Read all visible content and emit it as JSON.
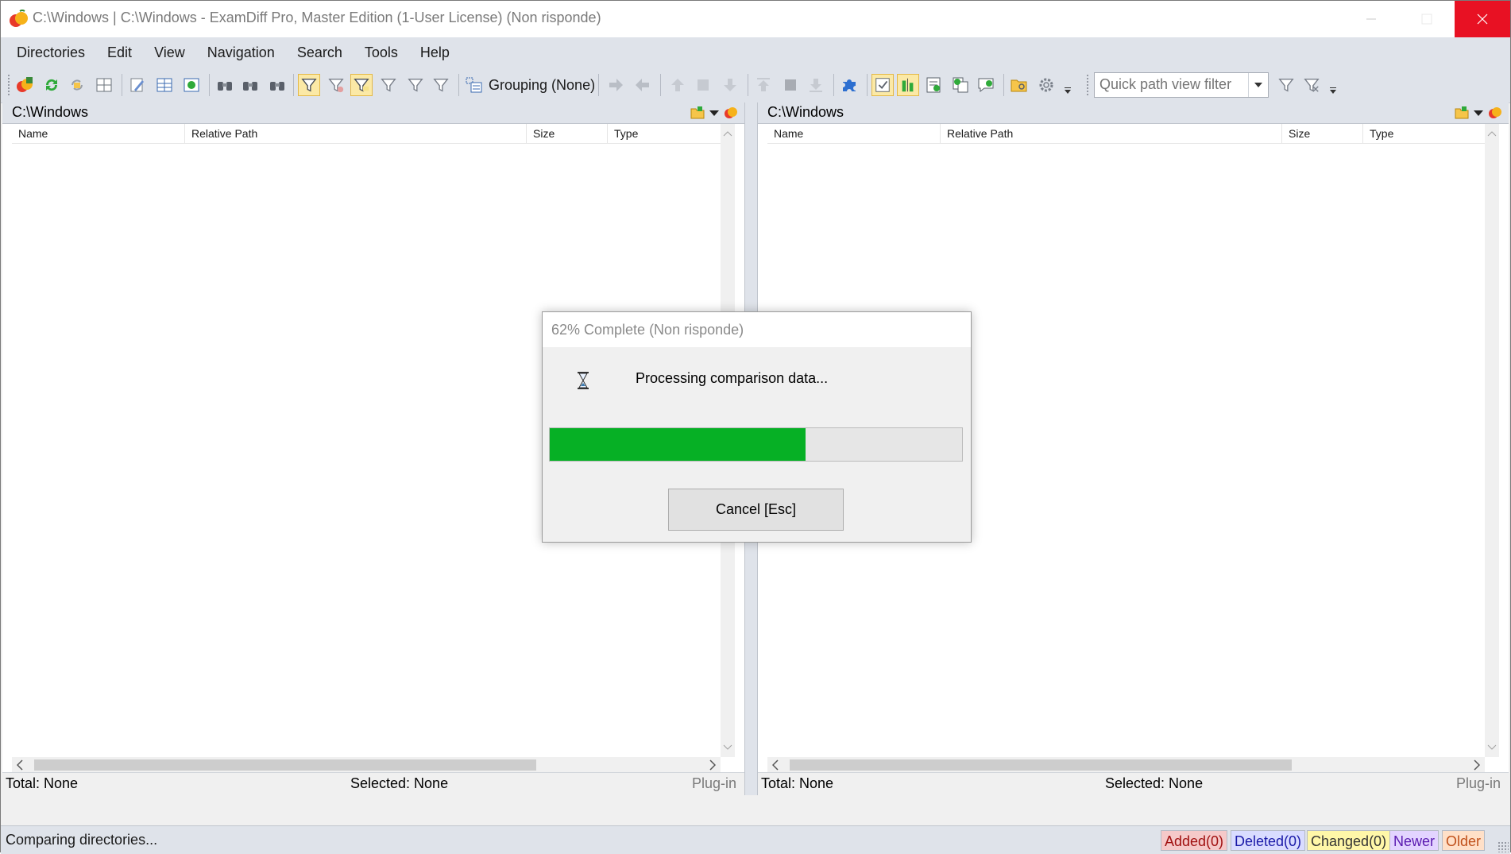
{
  "window": {
    "title": "C:\\Windows  |  C:\\Windows - ExamDiff Pro, Master Edition (1-User License) (Non risponde)"
  },
  "menu": [
    "Directories",
    "Edit",
    "View",
    "Navigation",
    "Search",
    "Tools",
    "Help"
  ],
  "toolbar": {
    "grouping_label": "Grouping (None)",
    "quick_filter_placeholder": "Quick path view filter"
  },
  "left_pane": {
    "path": "C:\\Windows",
    "columns": [
      "Name",
      "Relative Path",
      "Size",
      "Type"
    ],
    "total": "Total: None",
    "selected": "Selected: None",
    "plugin": "Plug-in"
  },
  "right_pane": {
    "path": "C:\\Windows",
    "columns": [
      "Name",
      "Relative Path",
      "Size",
      "Type"
    ],
    "total": "Total: None",
    "selected": "Selected: None",
    "plugin": "Plug-in"
  },
  "statusbar": {
    "text": "Comparing directories...",
    "legend": [
      {
        "label": "Added(0)",
        "bg": "#f5c9c9",
        "fg": "#a01010"
      },
      {
        "label": "Deleted(0)",
        "bg": "#d9dcff",
        "fg": "#1a1aa8"
      },
      {
        "label": "Changed(0)",
        "bg": "#fff7a8",
        "fg": "#333333"
      },
      {
        "label": "Newer",
        "bg": "#e3d4ff",
        "fg": "#5a1ab0"
      },
      {
        "label": "Older",
        "bg": "#ffe0c8",
        "fg": "#c0501a"
      }
    ]
  },
  "dialog": {
    "title": "62% Complete (Non risponde)",
    "message": "Processing comparison data...",
    "progress": 0.62,
    "cancel_label": "Cancel [Esc]",
    "progress_color": "#06b025"
  },
  "colors": {
    "menubar_bg": "#dfe3ea",
    "close_button": "#e81123"
  }
}
